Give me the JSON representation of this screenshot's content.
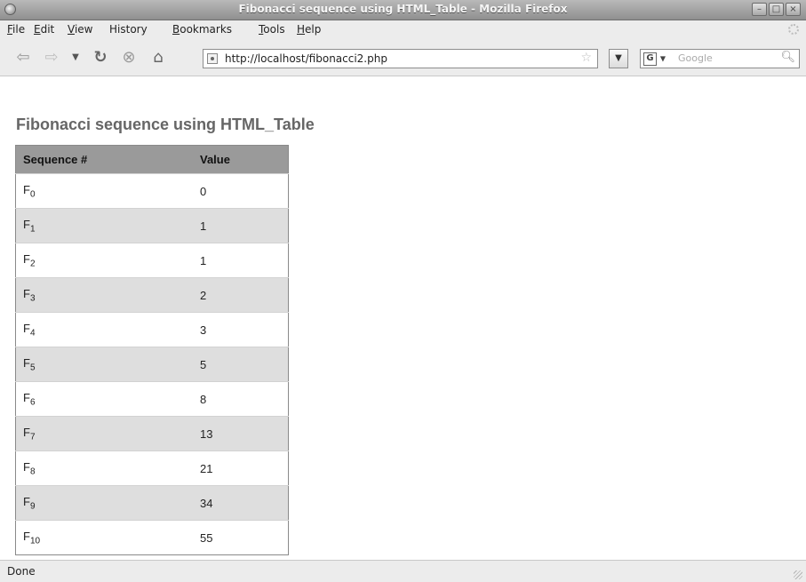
{
  "window": {
    "title": "Fibonacci sequence using HTML_Table - Mozilla Firefox",
    "buttons": {
      "minimize": "–",
      "maximize": "□",
      "close": "×"
    }
  },
  "menu": {
    "items": [
      {
        "label": "File",
        "accel": "F",
        "rest": "ile"
      },
      {
        "label": "Edit",
        "accel": "E",
        "rest": "dit"
      },
      {
        "label": "View",
        "accel": "V",
        "rest": "iew"
      },
      {
        "label": "History",
        "accel": "",
        "rest": "History"
      },
      {
        "label": "Bookmarks",
        "accel": "B",
        "rest": "ookmarks"
      },
      {
        "label": "Tools",
        "accel": "T",
        "rest": "ools"
      },
      {
        "label": "Help",
        "accel": "H",
        "rest": "elp"
      }
    ]
  },
  "toolbar": {
    "back_icon": "back-arrow-icon",
    "forward_icon": "forward-arrow-icon",
    "reload_icon": "reload-icon",
    "stop_icon": "stop-icon",
    "home_icon": "home-icon",
    "url": "http://localhost/fibonacci2.php",
    "search_placeholder": "Google",
    "search_engine_letter": "G"
  },
  "page": {
    "heading": "Fibonacci sequence using HTML_Table",
    "table": {
      "headers": [
        "Sequence #",
        "Value"
      ],
      "rows": [
        {
          "label": "F",
          "index": "0",
          "value": "0"
        },
        {
          "label": "F",
          "index": "1",
          "value": "1"
        },
        {
          "label": "F",
          "index": "2",
          "value": "1"
        },
        {
          "label": "F",
          "index": "3",
          "value": "2"
        },
        {
          "label": "F",
          "index": "4",
          "value": "3"
        },
        {
          "label": "F",
          "index": "5",
          "value": "5"
        },
        {
          "label": "F",
          "index": "6",
          "value": "8"
        },
        {
          "label": "F",
          "index": "7",
          "value": "13"
        },
        {
          "label": "F",
          "index": "8",
          "value": "21"
        },
        {
          "label": "F",
          "index": "9",
          "value": "34"
        },
        {
          "label": "F",
          "index": "10",
          "value": "55"
        }
      ]
    }
  },
  "status": {
    "text": "Done"
  }
}
